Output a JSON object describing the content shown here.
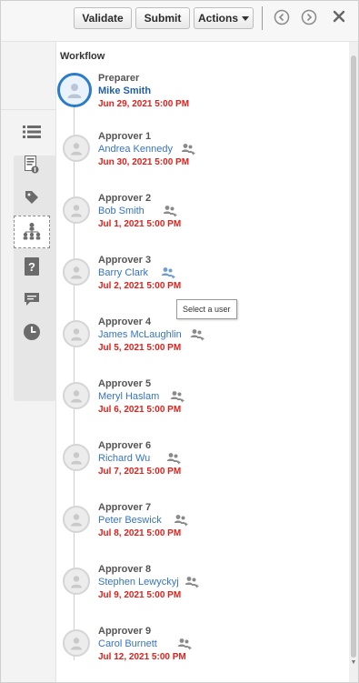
{
  "toolbar": {
    "validate_label": "Validate",
    "submit_label": "Submit",
    "actions_label": "Actions"
  },
  "panel": {
    "title": "Workflow",
    "tooltip": "Select a user"
  },
  "steps": [
    {
      "role": "Preparer",
      "name": "Mike Smith",
      "due": "Jun 29, 2021 5:00 PM"
    },
    {
      "role": "Approver 1",
      "name": "Andrea Kennedy",
      "due": "Jun 30, 2021 5:00 PM"
    },
    {
      "role": "Approver 2",
      "name": "Bob Smith",
      "due": "Jul 1, 2021 5:00 PM"
    },
    {
      "role": "Approver 3",
      "name": "Barry Clark",
      "due": "Jul 2, 2021 5:00 PM"
    },
    {
      "role": "Approver 4",
      "name": "James McLaughlin",
      "due": "Jul 5, 2021 5:00 PM"
    },
    {
      "role": "Approver 5",
      "name": "Meryl Haslam",
      "due": "Jul 6, 2021 5:00 PM"
    },
    {
      "role": "Approver 6",
      "name": "Richard Wu",
      "due": "Jul 7, 2021 5:00 PM"
    },
    {
      "role": "Approver 7",
      "name": "Peter Beswick",
      "due": "Jul 8, 2021 5:00 PM"
    },
    {
      "role": "Approver 8",
      "name": "Stephen Lewyckyj",
      "due": "Jul 9, 2021 5:00 PM"
    },
    {
      "role": "Approver 9",
      "name": "Carol Burnett",
      "due": "Jul 12, 2021 5:00 PM"
    }
  ],
  "sidebar_icons": [
    "list-icon",
    "document-icon",
    "tag-icon",
    "hierarchy-icon",
    "help-icon",
    "comment-icon",
    "clock-icon"
  ],
  "colors": {
    "accent": "#2a7bc8",
    "link": "#3574c4",
    "due_date": "#e0201b"
  }
}
